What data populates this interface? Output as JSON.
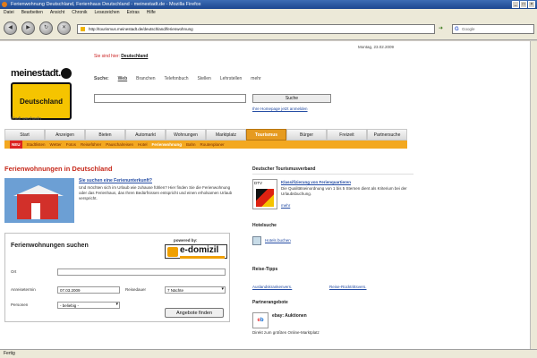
{
  "browser": {
    "title": "Ferienwohnung Deutschland, Ferienhaus Deutschland - meinestadt.de - Mozilla Firefox",
    "menu": [
      "Datei",
      "Bearbeiten",
      "Ansicht",
      "Chronik",
      "Lesezeichen",
      "Extras",
      "Hilfe"
    ],
    "url": "http://tourismus.meinestadt.de/deutschland/ferienwohnung",
    "search_placeholder": "Google",
    "status": "Fertig"
  },
  "site": {
    "logo_text": "meinestadt.de",
    "logo_sign": "Deutschland",
    "city_btn": "Stadt wechseln",
    "date": "Montag, 23.02.2009",
    "location_label": "Sie sind hier:",
    "location_value": "Deutschland",
    "search_label": "Suche:",
    "search_options": [
      "Web",
      "Branchen",
      "Telefonbuch",
      "Stellen",
      "Lehrstellen",
      "mehr"
    ],
    "search_button": "Suche",
    "homepage_link": "Ihre Homepage jetzt anmelden",
    "tabs": [
      "Start",
      "Anzeigen",
      "Bieten",
      "Automarkt",
      "Wohnungen",
      "Marktplatz",
      "Tourismus",
      "Bürger",
      "Freizeit",
      "Partnersuche"
    ],
    "active_tab": "Tourismus",
    "subnav_new": "NEU",
    "subnav": [
      "Stadtlisten",
      "Wetter",
      "Fotos",
      "Reiseführer",
      "Pauschalreisen",
      "Hotel",
      "Ferienwohnung",
      "Bahn",
      "Routenplaner"
    ],
    "subnav_current": "Ferienwohnung"
  },
  "main": {
    "heading": "Ferienwohnungen in Deutschland",
    "promo_title": "Sie suchen eine Ferienunterkunft?",
    "promo_text": "Und möchten sich im Urlaub wie zuhause fühlen? Hier finden Sie die Ferienwohnung oder das Ferienhaus, das Ihren Bedürfnissen entspricht und einen erholsamen Urlaub verspricht.",
    "search_box": {
      "title": "Ferienwohnungen suchen",
      "powered_by": "powered by:",
      "partner": "e-domizil",
      "ort_label": "Ort",
      "ort_value": "",
      "arrival_label": "Anreisetermin",
      "arrival_value": "07.03.2009",
      "duration_label": "Reisedauer",
      "duration_value": "7 Nächte",
      "persons_label": "Personen",
      "persons_value": "- beliebig -",
      "find_button": "Angebote finden"
    }
  },
  "sidebar": {
    "tourism_heading": "Deutscher Tourismusverband",
    "dtv_logo": "DTV",
    "classification_link": "Klassifizierung von Ferienquartieren",
    "classification_text": "Die Qualitätseinordnung von 1 bis 5 Sternen dient als Kriterium bei der Urlaubsbuchung.",
    "more_link": "mehr",
    "hotel_heading": "Hotelsuche",
    "hotel_link": "Hotels buchen",
    "tips_heading": "Reise-Tipps",
    "tip1": "Auslandskrankenvers.",
    "tip2": "Reise-Rücktrittsvers.",
    "partner_heading": "Partnerangebote",
    "ebay_title": "ebay: Auktionen",
    "ebay_text": "Direkt zum größten Online-Marktplatz"
  }
}
